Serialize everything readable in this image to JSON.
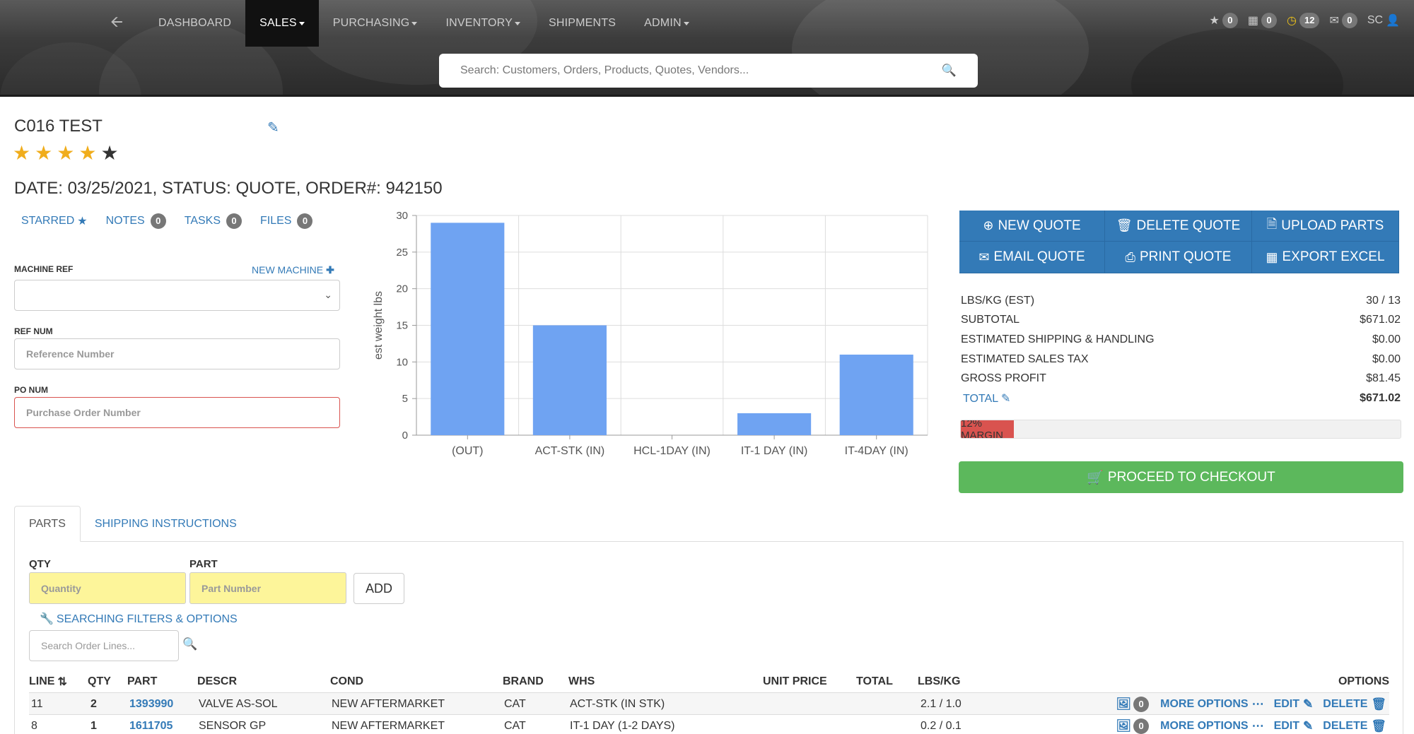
{
  "nav": {
    "items": [
      "DASHBOARD",
      "SALES",
      "PURCHASING",
      "INVENTORY",
      "SHIPMENTS",
      "ADMIN"
    ],
    "active": "SALES",
    "right": {
      "starred_count": "0",
      "calendar_count": "0",
      "clock_count": "12",
      "mail_count": "0",
      "user_initials": "SC"
    }
  },
  "search": {
    "placeholder": "Search: Customers, Orders, Products, Quotes, Vendors..."
  },
  "customer": {
    "name": "C016 TEST",
    "rating": 4,
    "rating_max": 5,
    "order_line": "DATE: 03/25/2021, STATUS: QUOTE, ORDER#: 942150"
  },
  "links": {
    "starred": "STARRED",
    "notes": "NOTES",
    "notes_count": "0",
    "tasks": "TASKS",
    "tasks_count": "0",
    "files": "FILES",
    "files_count": "0"
  },
  "form": {
    "machine_ref_label": "MACHINE REF",
    "new_machine": "NEW MACHINE",
    "ref_num_label": "REF NUM",
    "ref_num_placeholder": "Reference Number",
    "po_num_label": "PO NUM",
    "po_num_placeholder": "Purchase Order Number"
  },
  "chart_data": {
    "type": "bar",
    "categories": [
      "(OUT)",
      "ACT-STK (IN)",
      "HCL-1DAY (IN)",
      "IT-1 DAY (IN)",
      "IT-4DAY (IN)"
    ],
    "values": [
      29,
      15,
      0,
      3,
      11
    ],
    "ylabel": "est weight lbs",
    "ylim": [
      0,
      30
    ],
    "yticks": [
      0,
      5,
      10,
      15,
      20,
      25,
      30
    ],
    "grid": true,
    "bar_color": "#6fa3f2"
  },
  "quote_buttons": {
    "new_quote": "NEW QUOTE",
    "delete_quote": "DELETE QUOTE",
    "upload_parts": "UPLOAD PARTS",
    "email_quote": "EMAIL QUOTE",
    "print_quote": "PRINT QUOTE",
    "export_excel": "EXPORT EXCEL"
  },
  "summary": [
    {
      "label": "LBS/KG (EST)",
      "value": "30 / 13"
    },
    {
      "label": "SUBTOTAL",
      "value": "$671.02"
    },
    {
      "label": "ESTIMATED SHIPPING & HANDLING",
      "value": "$0.00"
    },
    {
      "label": "ESTIMATED SALES TAX",
      "value": "$0.00"
    },
    {
      "label": "GROSS PROFIT",
      "value": "$81.45"
    },
    {
      "label": "TOTAL",
      "value": "$671.02"
    }
  ],
  "margin": {
    "label": "12% MARGIN",
    "percent": 12,
    "color": "#d9534f"
  },
  "checkout": {
    "label": "PROCEED TO CHECKOUT"
  },
  "tabs": [
    "PARTS",
    "SHIPPING INSTRUCTIONS"
  ],
  "add_part": {
    "qty_label": "QTY",
    "qty_placeholder": "Quantity",
    "part_label": "PART",
    "part_placeholder": "Part Number",
    "add_button": "ADD",
    "filters_link": "SEARCHING FILTERS & OPTIONS",
    "search_placeholder": "Search Order Lines..."
  },
  "table": {
    "headers": {
      "line": "LINE",
      "qty": "QTY",
      "part": "PART",
      "descr": "DESCR",
      "cond": "COND",
      "brand": "BRAND",
      "whs": "WHS",
      "unit_price": "UNIT PRICE",
      "total": "TOTAL",
      "lbs_kg": "LBS/KG",
      "options": "OPTIONS"
    },
    "rows": [
      {
        "line": "11",
        "qty": "2",
        "part": "1393990",
        "descr": "VALVE AS-SOL",
        "cond": "NEW AFTERMARKET",
        "brand": "CAT",
        "whs": "ACT-STK (IN STK)",
        "unit_price": "",
        "total": "",
        "lbs_kg": "2.1 / 1.0",
        "images": "0"
      },
      {
        "line": "8",
        "qty": "1",
        "part": "1611705",
        "descr": "SENSOR GP",
        "cond": "NEW AFTERMARKET",
        "brand": "CAT",
        "whs": "IT-1 DAY (1-2 DAYS)",
        "unit_price": "",
        "total": "",
        "lbs_kg": "0.2 / 0.1",
        "images": "0"
      }
    ],
    "row_actions": {
      "more": "MORE OPTIONS",
      "edit": "EDIT",
      "delete": "DELETE"
    }
  },
  "colors": {
    "primary": "#337ab7",
    "success": "#5cb85c",
    "danger": "#d9534f",
    "star": "#f0ad1c"
  }
}
